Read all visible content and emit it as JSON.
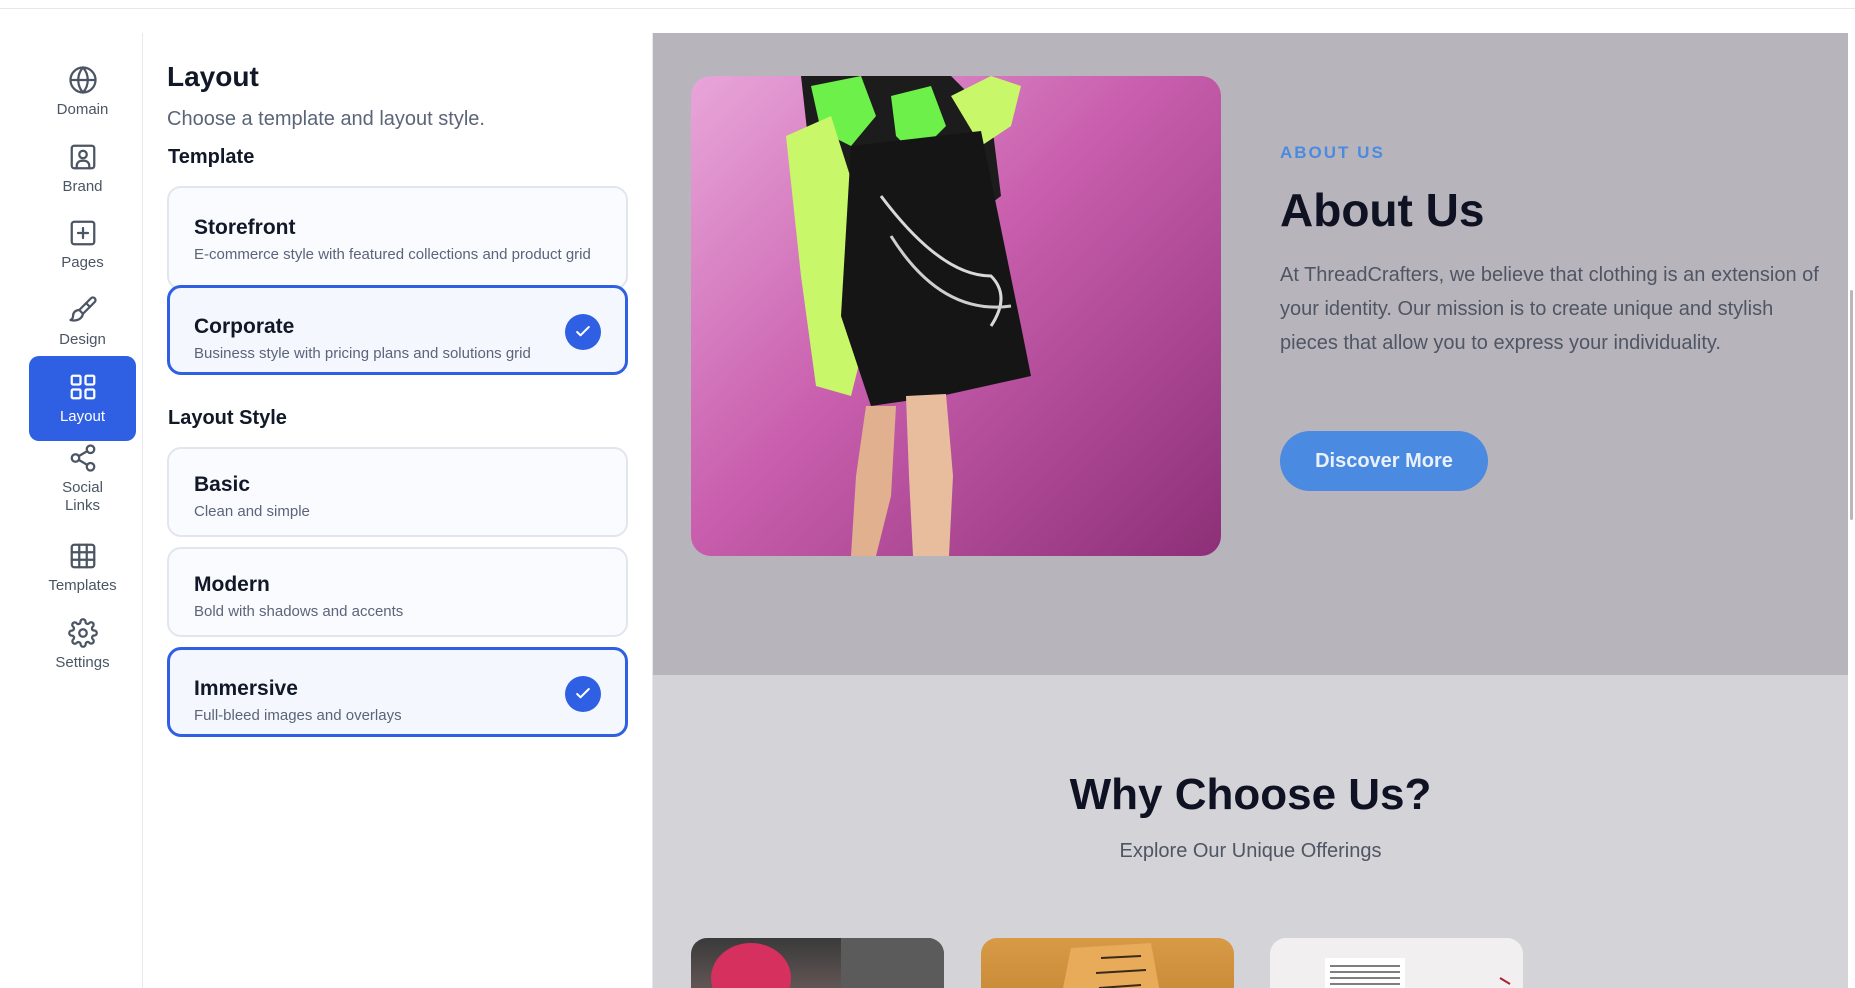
{
  "nav": {
    "items": [
      {
        "label": "Domain",
        "icon": "globe-icon",
        "active": false
      },
      {
        "label": "Brand",
        "icon": "brand-portrait-icon",
        "active": false
      },
      {
        "label": "Pages",
        "icon": "add-page-icon",
        "active": false
      },
      {
        "label": "Design",
        "icon": "paintbrush-icon",
        "active": false
      },
      {
        "label": "Layout",
        "icon": "layout-grid-icon",
        "active": true
      },
      {
        "label": "Social\nLinks",
        "icon": "share-icon",
        "active": false
      },
      {
        "label": "Templates",
        "icon": "table-grid-icon",
        "active": false
      },
      {
        "label": "Settings",
        "icon": "gear-icon",
        "active": false
      }
    ]
  },
  "panel": {
    "title": "Layout",
    "subtitle": "Choose a template and layout style.",
    "template_heading": "Template",
    "templates": [
      {
        "title": "Storefront",
        "desc": "E-commerce style with featured collections and product grid",
        "selected": false
      },
      {
        "title": "Corporate",
        "desc": "Business style with pricing plans and solutions grid",
        "selected": true
      }
    ],
    "layout_heading": "Layout Style",
    "layout_styles": [
      {
        "title": "Basic",
        "desc": "Clean and simple",
        "selected": false
      },
      {
        "title": "Modern",
        "desc": "Bold with shadows and accents",
        "selected": false
      },
      {
        "title": "Immersive",
        "desc": "Full-bleed images and overlays",
        "selected": true
      }
    ]
  },
  "preview": {
    "about": {
      "eyebrow": "ABOUT US",
      "title": "About Us",
      "body": "At ThreadCrafters, we believe that clothing is an extension of your identity. Our mission is to create unique and stylish pieces that allow you to express your individuality.",
      "button": "Discover More"
    },
    "why": {
      "title": "Why Choose Us?",
      "subtitle": "Explore Our Unique Offerings"
    }
  },
  "colors": {
    "accent": "#2f5fe3",
    "preview_accent": "#4a8ae0",
    "about_bg": "#b7b5bb",
    "why_bg": "#d4d3d7"
  }
}
